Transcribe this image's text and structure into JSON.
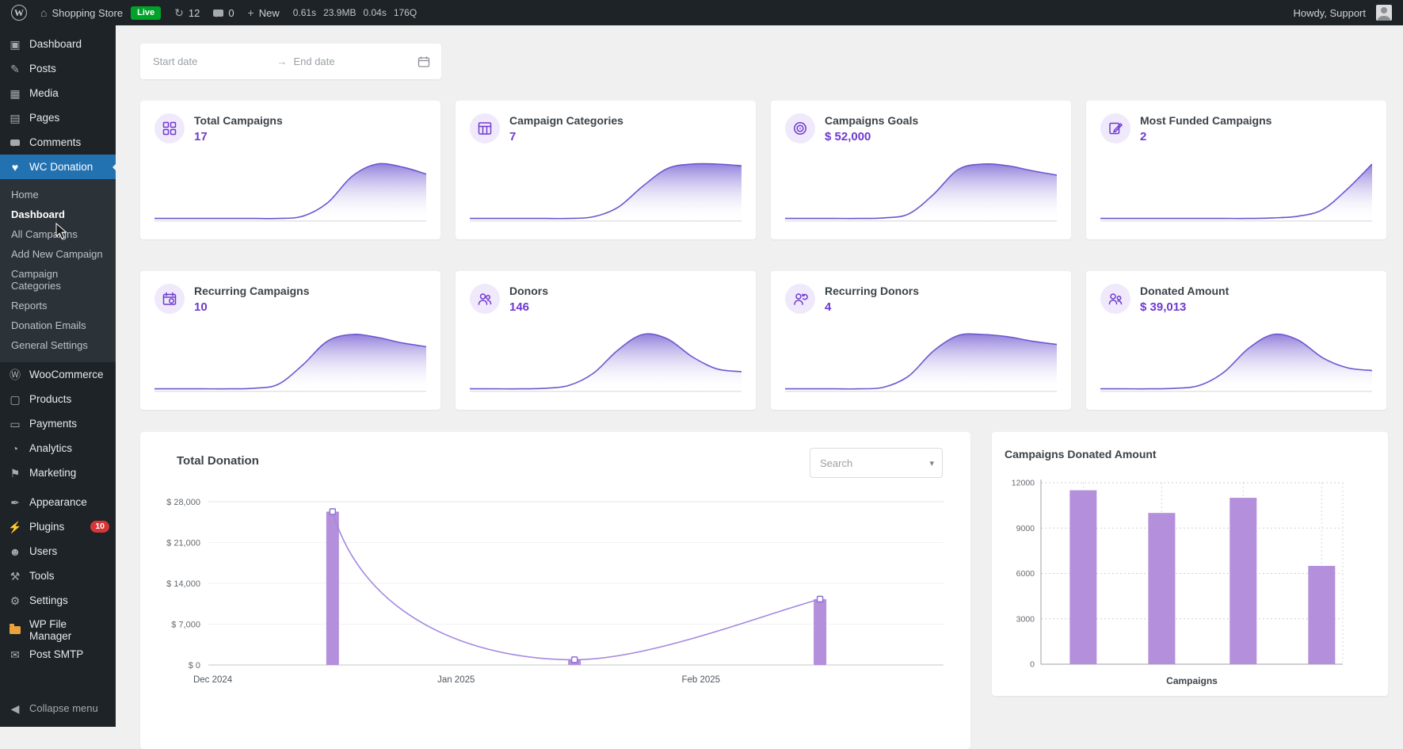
{
  "admin_bar": {
    "site_name": "Shopping Store",
    "live_badge": "Live",
    "updates_count": "12",
    "comments_count": "0",
    "new_label": "New",
    "qm_stats": [
      "0.61s",
      "23.9MB",
      "0.04s",
      "176Q"
    ],
    "howdy": "Howdy, Support"
  },
  "icon_glyphs": {
    "wordpress-logo": "W",
    "home": "⌂",
    "updates": "↻",
    "plus": "+",
    "caret-down": "▾",
    "range-arrow": "→",
    "collapse": "◀"
  },
  "sidebar": {
    "items": [
      {
        "label": "Dashboard",
        "icon": "dashboard-icon",
        "glyph": "▣"
      },
      {
        "label": "Posts",
        "icon": "posts-icon",
        "glyph": "✎"
      },
      {
        "label": "Media",
        "icon": "media-icon",
        "glyph": "▦"
      },
      {
        "label": "Pages",
        "icon": "pages-icon",
        "glyph": "▤"
      },
      {
        "label": "Comments",
        "icon": "comments-icon",
        "bubble": true
      },
      {
        "label": "WC Donation",
        "icon": "heart-icon",
        "glyph": "♥",
        "active": true
      },
      {
        "label": "WooCommerce",
        "icon": "woocommerce-icon",
        "glyph": "Ⓦ"
      },
      {
        "label": "Products",
        "icon": "products-icon",
        "glyph": "▢"
      },
      {
        "label": "Payments",
        "icon": "payments-icon",
        "glyph": "▭"
      },
      {
        "label": "Analytics",
        "icon": "analytics-icon",
        "glyph": "◔"
      },
      {
        "label": "Marketing",
        "icon": "marketing-icon",
        "glyph": "⚑"
      },
      {
        "label": "Appearance",
        "icon": "appearance-icon",
        "glyph": "✒",
        "separator_before": true
      },
      {
        "label": "Plugins",
        "icon": "plugins-icon",
        "glyph": "⚡",
        "badge": "10"
      },
      {
        "label": "Users",
        "icon": "users-icon",
        "glyph": "☻"
      },
      {
        "label": "Tools",
        "icon": "tools-icon",
        "glyph": "⚒"
      },
      {
        "label": "Settings",
        "icon": "settings-icon",
        "glyph": "⚙"
      },
      {
        "label": "WP File Manager",
        "icon": "folder-icon",
        "folder": true,
        "separator_before": true
      },
      {
        "label": "Post SMTP",
        "icon": "mail-icon",
        "glyph": "✉"
      }
    ],
    "submenu": {
      "parent": "WC Donation",
      "items": [
        {
          "label": "Home"
        },
        {
          "label": "Dashboard",
          "current": true
        },
        {
          "label": "All Campaigns"
        },
        {
          "label": "Add New Campaign"
        },
        {
          "label": "Campaign Categories"
        },
        {
          "label": "Reports"
        },
        {
          "label": "Donation Emails"
        },
        {
          "label": "General Settings"
        }
      ]
    },
    "collapse_label": "Collapse menu"
  },
  "filters": {
    "start_date_placeholder": "Start date",
    "end_date_placeholder": "End date"
  },
  "stat_cards": [
    {
      "title": "Total Campaigns",
      "value": "17",
      "icon": "grid-icon",
      "sparkline": [
        0.02,
        0.02,
        0.02,
        0.02,
        0.02,
        0.02,
        0.06,
        0.3,
        0.78,
        1.0,
        0.95,
        0.82
      ]
    },
    {
      "title": "Campaign Categories",
      "value": "7",
      "icon": "category-table-icon",
      "sparkline": [
        0.02,
        0.02,
        0.02,
        0.02,
        0.02,
        0.05,
        0.22,
        0.6,
        0.92,
        1.0,
        1.0,
        0.97
      ]
    },
    {
      "title": "Campaigns Goals",
      "value": "$ 52,000",
      "icon": "target-icon",
      "sparkline": [
        0.02,
        0.02,
        0.02,
        0.02,
        0.03,
        0.1,
        0.45,
        0.9,
        1.0,
        0.97,
        0.88,
        0.8
      ]
    },
    {
      "title": "Most Funded Campaigns",
      "value": "2",
      "icon": "pencil-note-icon",
      "sparkline": [
        0.02,
        0.02,
        0.02,
        0.02,
        0.02,
        0.02,
        0.02,
        0.03,
        0.06,
        0.18,
        0.55,
        1.0
      ]
    },
    {
      "title": "Recurring Campaigns",
      "value": "10",
      "icon": "calendar-recurring-icon",
      "sparkline": [
        0.02,
        0.02,
        0.02,
        0.02,
        0.03,
        0.1,
        0.45,
        0.88,
        1.0,
        0.95,
        0.85,
        0.78
      ]
    },
    {
      "title": "Donors",
      "value": "146",
      "icon": "people-icon",
      "sparkline": [
        0.02,
        0.02,
        0.02,
        0.03,
        0.08,
        0.3,
        0.72,
        1.0,
        0.92,
        0.6,
        0.38,
        0.33
      ]
    },
    {
      "title": "Recurring Donors",
      "value": "4",
      "icon": "person-refresh-icon",
      "sparkline": [
        0.02,
        0.02,
        0.02,
        0.02,
        0.05,
        0.25,
        0.7,
        0.98,
        1.0,
        0.96,
        0.88,
        0.82
      ]
    },
    {
      "title": "Donated Amount",
      "value": "$ 39,013",
      "icon": "people-money-icon",
      "sparkline": [
        0.02,
        0.02,
        0.02,
        0.03,
        0.08,
        0.32,
        0.75,
        1.0,
        0.9,
        0.58,
        0.4,
        0.35
      ]
    }
  ],
  "donation_panel": {
    "search_placeholder": "Search"
  },
  "chart_data": [
    {
      "type": "line+bar",
      "title": "Total Donation",
      "ylim": [
        0,
        28000
      ],
      "y_ticks": [
        0,
        7000,
        14000,
        21000,
        28000
      ],
      "y_tick_labels": [
        "$ 0",
        "$ 7,000",
        "$ 14,000",
        "$ 21,000",
        "$ 28,000"
      ],
      "x_labels": [
        {
          "label": "Dec 2024",
          "frac": 0.006
        },
        {
          "label": "Jan 2025",
          "frac": 0.337
        },
        {
          "label": "Feb 2025",
          "frac": 0.67
        }
      ],
      "points": [
        {
          "frac": 0.169,
          "value": 26300
        },
        {
          "frac": 0.498,
          "value": 900
        },
        {
          "frac": 0.832,
          "value": 11300
        }
      ],
      "legend": "none",
      "grid": "horizontal-faint"
    },
    {
      "type": "bar",
      "title": "Campaigns Donated Amount",
      "xlabel": "Campaigns",
      "ylim": [
        0,
        12000
      ],
      "y_ticks": [
        0,
        3000,
        6000,
        9000,
        12000
      ],
      "bars": [
        {
          "frac": 0.14,
          "value": 11500
        },
        {
          "frac": 0.4,
          "value": 10000
        },
        {
          "frac": 0.67,
          "value": 11000
        },
        {
          "frac": 0.93,
          "value": 6500
        }
      ],
      "grid": "dashed-both",
      "legend": "none"
    }
  ],
  "colors": {
    "accent_purple": "#6f3ad0",
    "sparkline_stroke": "#6e56cf",
    "chart_bar": "#b48fdb",
    "chart_line": "#a588e0",
    "marker_border": "#8b6cd9",
    "active_blue": "#2271b1",
    "live_green": "#00a32a",
    "badge_red": "#d63638",
    "icon_circle_bg": "#efe9fb"
  }
}
